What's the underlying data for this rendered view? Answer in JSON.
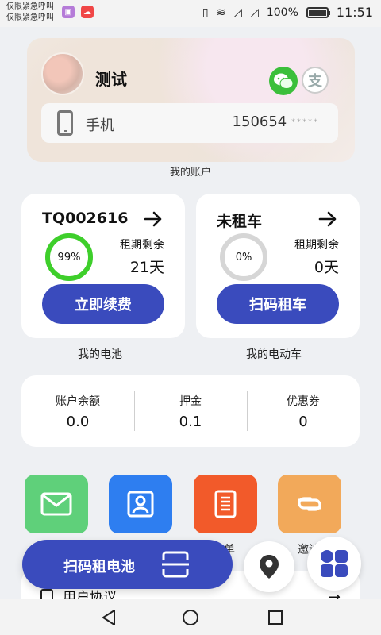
{
  "statusbar": {
    "line1": "仅限紧急呼叫",
    "line2": "仅限紧急呼叫",
    "battery": "100%",
    "time": "11:51"
  },
  "account": {
    "name": "测试",
    "phone_label": "手机",
    "phone_number": "150654",
    "phone_mask": "*****",
    "caption": "我的账户",
    "alipay_glyph": "支"
  },
  "battery_card": {
    "title": "TQ002616",
    "progress_percent": 99,
    "progress_label": "99%",
    "remain_label": "租期剩余",
    "remain_value": "21天",
    "button_label": "立即续费",
    "caption": "我的电池",
    "ring_color": "#3ecf2b"
  },
  "vehicle_card": {
    "title": "未租车",
    "progress_percent": 0,
    "progress_label": "0%",
    "remain_label": "租期剩余",
    "remain_value": "0天",
    "button_label": "扫码租车",
    "caption": "我的电动车",
    "ring_color": "#cfcfcf"
  },
  "balance": {
    "items": [
      {
        "label": "账户余额",
        "value": "0.0"
      },
      {
        "label": "押金",
        "value": "0.1"
      },
      {
        "label": "优惠券",
        "value": "0"
      }
    ]
  },
  "grid": {
    "items": [
      {
        "name": "mail",
        "color": "#5fd07a",
        "label": ""
      },
      {
        "name": "contacts",
        "color": "#2e7ef0",
        "label": ""
      },
      {
        "name": "orders",
        "color": "#f25a2a",
        "label": "单"
      },
      {
        "name": "invite",
        "color": "#f2a95a",
        "label": "邀请"
      }
    ]
  },
  "agreement": {
    "label": "用户协议"
  },
  "floating": {
    "scan_battery_label": "扫码租电池"
  },
  "colors": {
    "primary": "#3a4bbd"
  }
}
